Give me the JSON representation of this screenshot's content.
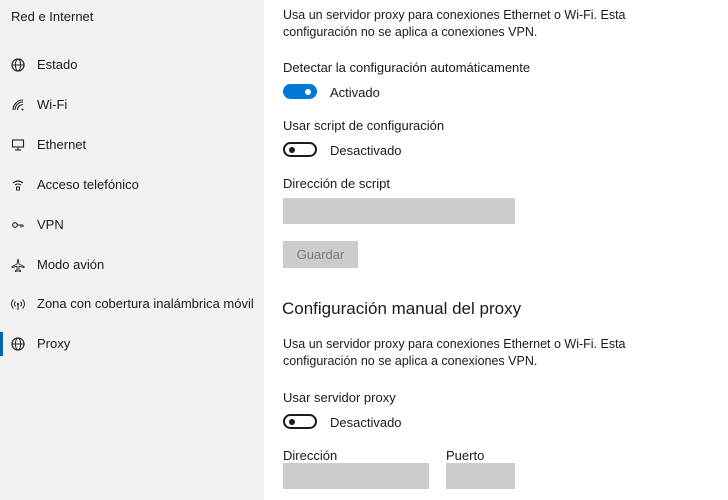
{
  "sidebar": {
    "title": "Red e Internet",
    "items": [
      {
        "label": "Estado",
        "icon": "globe-icon"
      },
      {
        "label": "Wi-Fi",
        "icon": "wifi-icon"
      },
      {
        "label": "Ethernet",
        "icon": "ethernet-icon"
      },
      {
        "label": "Acceso telefónico",
        "icon": "dial-up-icon"
      },
      {
        "label": "VPN",
        "icon": "vpn-icon"
      },
      {
        "label": "Modo avión",
        "icon": "airplane-icon"
      },
      {
        "label": "Zona con cobertura inalámbrica móvil",
        "icon": "mobile-hotspot-icon"
      },
      {
        "label": "Proxy",
        "icon": "globe-icon",
        "selected": true
      }
    ]
  },
  "auto": {
    "description_line1": "Usa un servidor proxy para conexiones Ethernet o Wi-Fi. Esta",
    "description_line2": "configuración no se aplica a conexiones VPN.",
    "detect_label": "Detectar la configuración automáticamente",
    "detect_state": "Activado",
    "detect_on": true,
    "script_label": "Usar script de configuración",
    "script_state": "Desactivado",
    "script_on": false,
    "script_address_label": "Dirección de script",
    "script_address_value": "",
    "save_label": "Guardar"
  },
  "manual": {
    "heading": "Configuración manual del proxy",
    "description_line1": "Usa un servidor proxy para conexiones Ethernet o Wi-Fi. Esta",
    "description_line2": "configuración no se aplica a conexiones VPN.",
    "use_proxy_label": "Usar servidor proxy",
    "use_proxy_state": "Desactivado",
    "use_proxy_on": false,
    "address_label": "Dirección",
    "address_value": "",
    "port_label": "Puerto",
    "port_value": ""
  },
  "colors": {
    "accent": "#0078d7",
    "sidebar_bg": "#f2f2f2",
    "field_bg": "#cccccc"
  }
}
